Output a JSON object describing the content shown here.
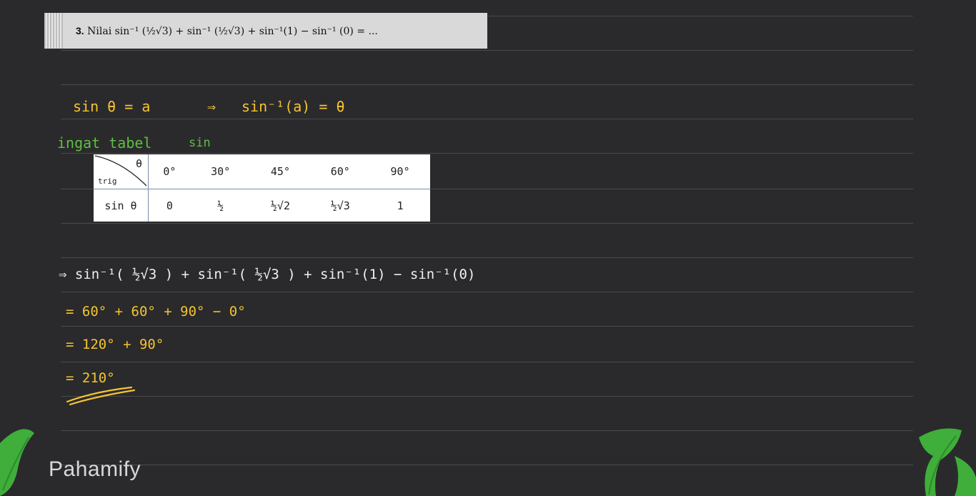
{
  "question": {
    "number": "3.",
    "text": "Nilai sin⁻¹ (½√3) + sin⁻¹ (½√3) + sin⁻¹(1) − sin⁻¹ (0) = ..."
  },
  "notes": {
    "definition_left": "sin θ = a",
    "arrow": "⇒",
    "definition_right": "sin⁻¹(a) = θ",
    "reminder": "ingat tabel",
    "reminder_sub": "sin"
  },
  "table": {
    "corner_theta": "θ",
    "corner_trig": "trig",
    "angles": [
      "0°",
      "30°",
      "45°",
      "60°",
      "90°"
    ],
    "row_label": "sin θ",
    "values": [
      "0",
      "½",
      "½√2",
      "½√3",
      "1"
    ]
  },
  "solution": {
    "line1": "⇒ sin⁻¹( ½√3 ) + sin⁻¹( ½√3 ) + sin⁻¹(1) − sin⁻¹(0)",
    "line2": "=   60° + 60° + 90° − 0°",
    "line3": "= 120° + 90°",
    "line4": "= 210°"
  },
  "brand": {
    "logo_text": "Pahamify"
  },
  "colors": {
    "background": "#2a2a2c",
    "handwriting_yellow": "#f5c431",
    "handwriting_green": "#5fbf42",
    "leaf_green": "#3fae3a"
  }
}
